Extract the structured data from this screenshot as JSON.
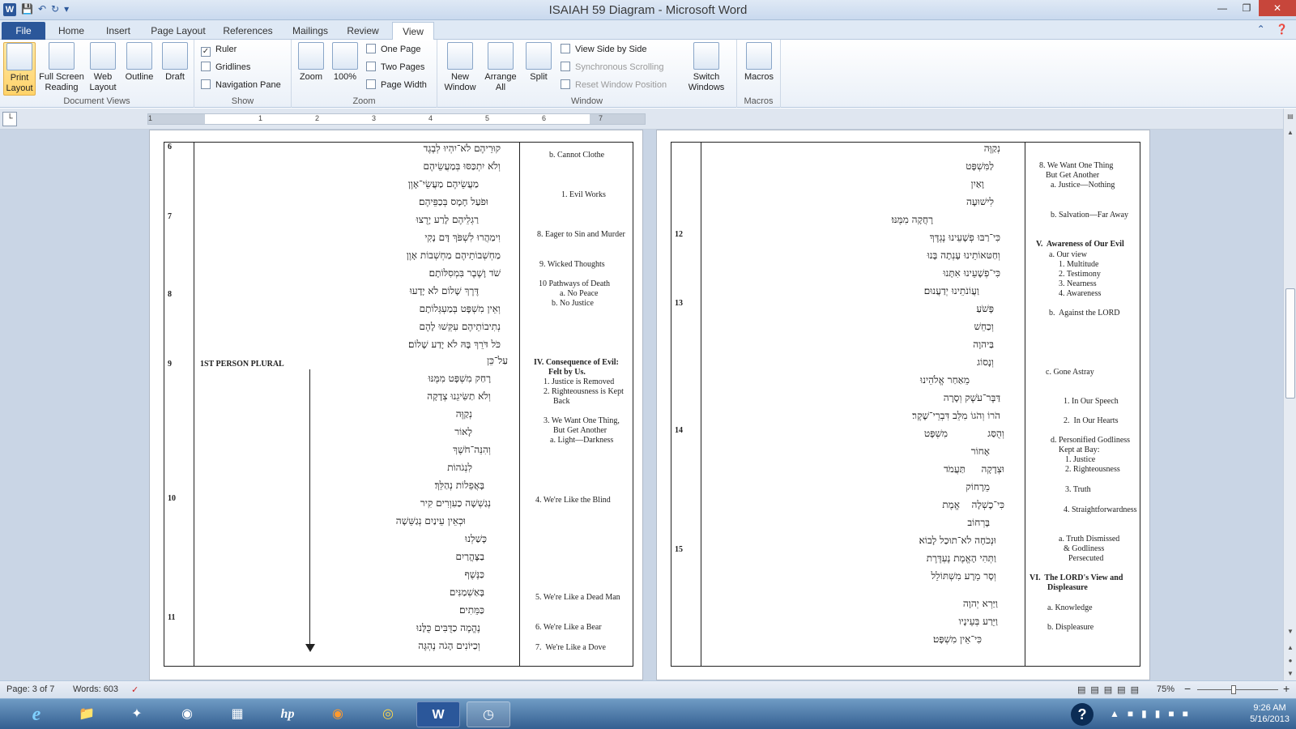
{
  "titlebar": {
    "title": "ISAIAH 59 Diagram  -  Microsoft Word",
    "app_icon": "W"
  },
  "tabs": {
    "file": "File",
    "items": [
      "Home",
      "Insert",
      "Page Layout",
      "References",
      "Mailings",
      "Review",
      "View"
    ],
    "active": "View"
  },
  "ribbon": {
    "document_views": {
      "label": "Document Views",
      "print_layout": "Print Layout",
      "full_screen_reading": "Full Screen Reading",
      "web_layout": "Web Layout",
      "outline": "Outline",
      "draft": "Draft"
    },
    "show": {
      "label": "Show",
      "ruler": "Ruler",
      "gridlines": "Gridlines",
      "navigation_pane": "Navigation Pane"
    },
    "zoom": {
      "label": "Zoom",
      "zoom": "Zoom",
      "hundred": "100%",
      "one_page": "One Page",
      "two_pages": "Two Pages",
      "page_width": "Page Width"
    },
    "window": {
      "label": "Window",
      "new_window": "New Window",
      "arrange_all": "Arrange All",
      "split": "Split",
      "view_side_by_side": "View Side by Side",
      "sync_scrolling": "Synchronous Scrolling",
      "reset_window": "Reset Window Position",
      "switch_windows": "Switch Windows"
    },
    "macros": {
      "label": "Macros",
      "macros": "Macros"
    }
  },
  "ruler_numbers": [
    "1",
    "1",
    "2",
    "3",
    "4",
    "5",
    "6",
    "7"
  ],
  "left_page": {
    "verse_numbers": [
      "6",
      "7",
      "8",
      "9",
      "10",
      "11"
    ],
    "person_label": "1ST PERSON PLURAL",
    "hebrew_lines": [
      "קוּרֵיהֶם לֹא־יִהְיוּ לְבֶגֶד",
      "וְלֹא יִתְכַּסּוּ בְּמַעֲשֵׂיהֶם",
      "מַעֲשֵׂיהֶם מַעֲשֵׂי־אָוֶן",
      "וּפֹעַל חָמָס בְּכַפֵּיהֶם׃",
      "רַגְלֵיהֶם לָרַע יָרֻצוּ",
      "וִימַהֲרוּ לִשְׁפֹּךְ דָּם נָקִי",
      "מַחְשְׁבוֹתֵיהֶם מַחְשְׁבוֹת אָוֶן",
      "שֹׁד וָשֶׁבֶר בִּמְסִלּוֹתָם׃",
      "דֶּרֶךְ שָׁלוֹם לֹא יָדָעוּ",
      "וְאֵין מִשְׁפָּט בְּמַעְגְּלוֹתָם",
      "נְתִיבוֹתֵיהֶם עִקְּשׁוּ לָהֶם",
      "כֹּל דֹּרֵךְ בָּהּ לֹא יָדַע שָׁלוֹם׃",
      "עַל־כֵּן",
      "רָחַק מִשְׁפָּט מִמֶּנּוּ",
      "וְלֹא תַשִּׂיגֵנוּ צְדָקָה",
      "נְקַוֶּה",
      "לָאוֹר",
      "וְהִנֵּה־חֹשֶׁךְ",
      "לִנְגֹהוֹת",
      "בָּאֲפֵלוֹת נְהַלֵּךְ׃",
      "נְגַשְׁשָׁה כַעִוְרִים קִיר",
      "וּכְאֵין עֵינַיִם נְגַשֵּׁשָׁה",
      "כָּשַׁלְנוּ",
      "בַצָּהֳרַיִם",
      "כַּנֶּשֶׁף",
      "בָּאַשְׁמַנִּים",
      "כַּמֵּתִים׃",
      "נֶהֱמֶה כַדֻּבִּים כֻּלָּנוּ",
      "וְכַיּוֹנִים הָגֹה נֶהְגֶּה"
    ],
    "notes": [
      "b. Cannot Clothe",
      "1. Evil Works",
      "8. Eager to Sin and Murder",
      "9. Wicked Thoughts",
      "10 Pathways of Death",
      "a. No Peace",
      "b. No Justice",
      "IV. Consequence of Evil:",
      "Felt by Us.",
      "1. Justice is Removed",
      "2. Righteousness is Kept",
      "Back",
      "3. We Want One Thing,",
      "But Get Another",
      "a. Light—Darkness",
      "4. We're Like the Blind",
      "5. We're Like a Dead Man",
      "6. We're Like a Bear",
      "7.  We're Like a Dove"
    ]
  },
  "right_page": {
    "verse_numbers": [
      "12",
      "13",
      "14",
      "15"
    ],
    "hebrew_lines": [
      "נְקַוֶּה",
      "לַמִּשְׁפָּט",
      "וָאַיִן",
      "לִישׁוּעָה",
      "רָחֲקָה מִמֶּנּוּ׃",
      "כִּי־רַבּוּ פְשָׁעֵינוּ נֶגְדֶּךָ",
      "וְחַטּאוֹתֵינוּ עָנְתָה בָּנוּ",
      "כִּי־פְשָׁעֵינוּ אִתָּנוּ",
      "וַעֲוֹנֹתֵינוּ יְדַעֲנוּם׃",
      "פָּשֹׁעַ",
      "וְכַחֵשׁ",
      "בַּיהוָה",
      "וְנָסוֹג",
      "מֵאַחַר אֱלֹהֵינוּ",
      "דַּבֶּר־עֹשֶׁק וְסָרָה",
      "הֹרוֹ וְהֹגוֹ מִלֵּב דִּבְרֵי־שָׁקֶר׃",
      "וְהֻסַּג",
      "מִשְׁפָּט",
      "אָחוֹר",
      "וּצְדָקָה",
      "תַּעֲמֹד",
      "מֵרָחוֹק",
      "כִּי־כָשְׁלָה",
      "אֱמֶת",
      "בָּרְחוֹב",
      "וּנְכֹחָה לֹא־תוּכַל לָבוֹא׃",
      "וַתְּהִי הָאֱמֶת נֶעְדֶּרֶת",
      "וְסָר מֵרָע מִשְׁתּוֹלֵל",
      "וַיַּרְא יְהוָה",
      "וַיֵּרַע בְּעֵינָיו",
      "כִּי־אֵין מִשְׁפָּט׃"
    ],
    "notes": [
      "8. We Want One Thing",
      "But Get Another",
      "a. Justice—Nothing",
      "b. Salvation—Far Away",
      "V.  Awareness of Our Evil",
      "a. Our view",
      "1. Multitude",
      "2. Testimony",
      "3. Nearness",
      "4. Awareness",
      "b.  Against the LORD",
      "c. Gone Astray",
      "1. In Our Speech",
      "2.  In Our Hearts",
      "d. Personified Godliness",
      "Kept at Bay:",
      "1. Justice",
      "2. Righteousness",
      "3. Truth",
      "4. Straightforwardness",
      "a. Truth Dismissed",
      "& Godliness",
      "Persecuted",
      "VI.  The LORD's View and",
      "Displeasure",
      "a. Knowledge",
      "b. Displeasure"
    ]
  },
  "statusbar": {
    "page": "Page: 3 of 7",
    "words": "Words: 603",
    "zoom": "75%",
    "minus": "−",
    "plus": "+"
  },
  "taskbar": {
    "time": "9:26 AM",
    "date": "5/16/2013",
    "help": "?"
  },
  "colors": {
    "accent": "#2b579a",
    "hebrew_purple": "#6a2ca8",
    "hebrew_green": "#1aa04a"
  }
}
